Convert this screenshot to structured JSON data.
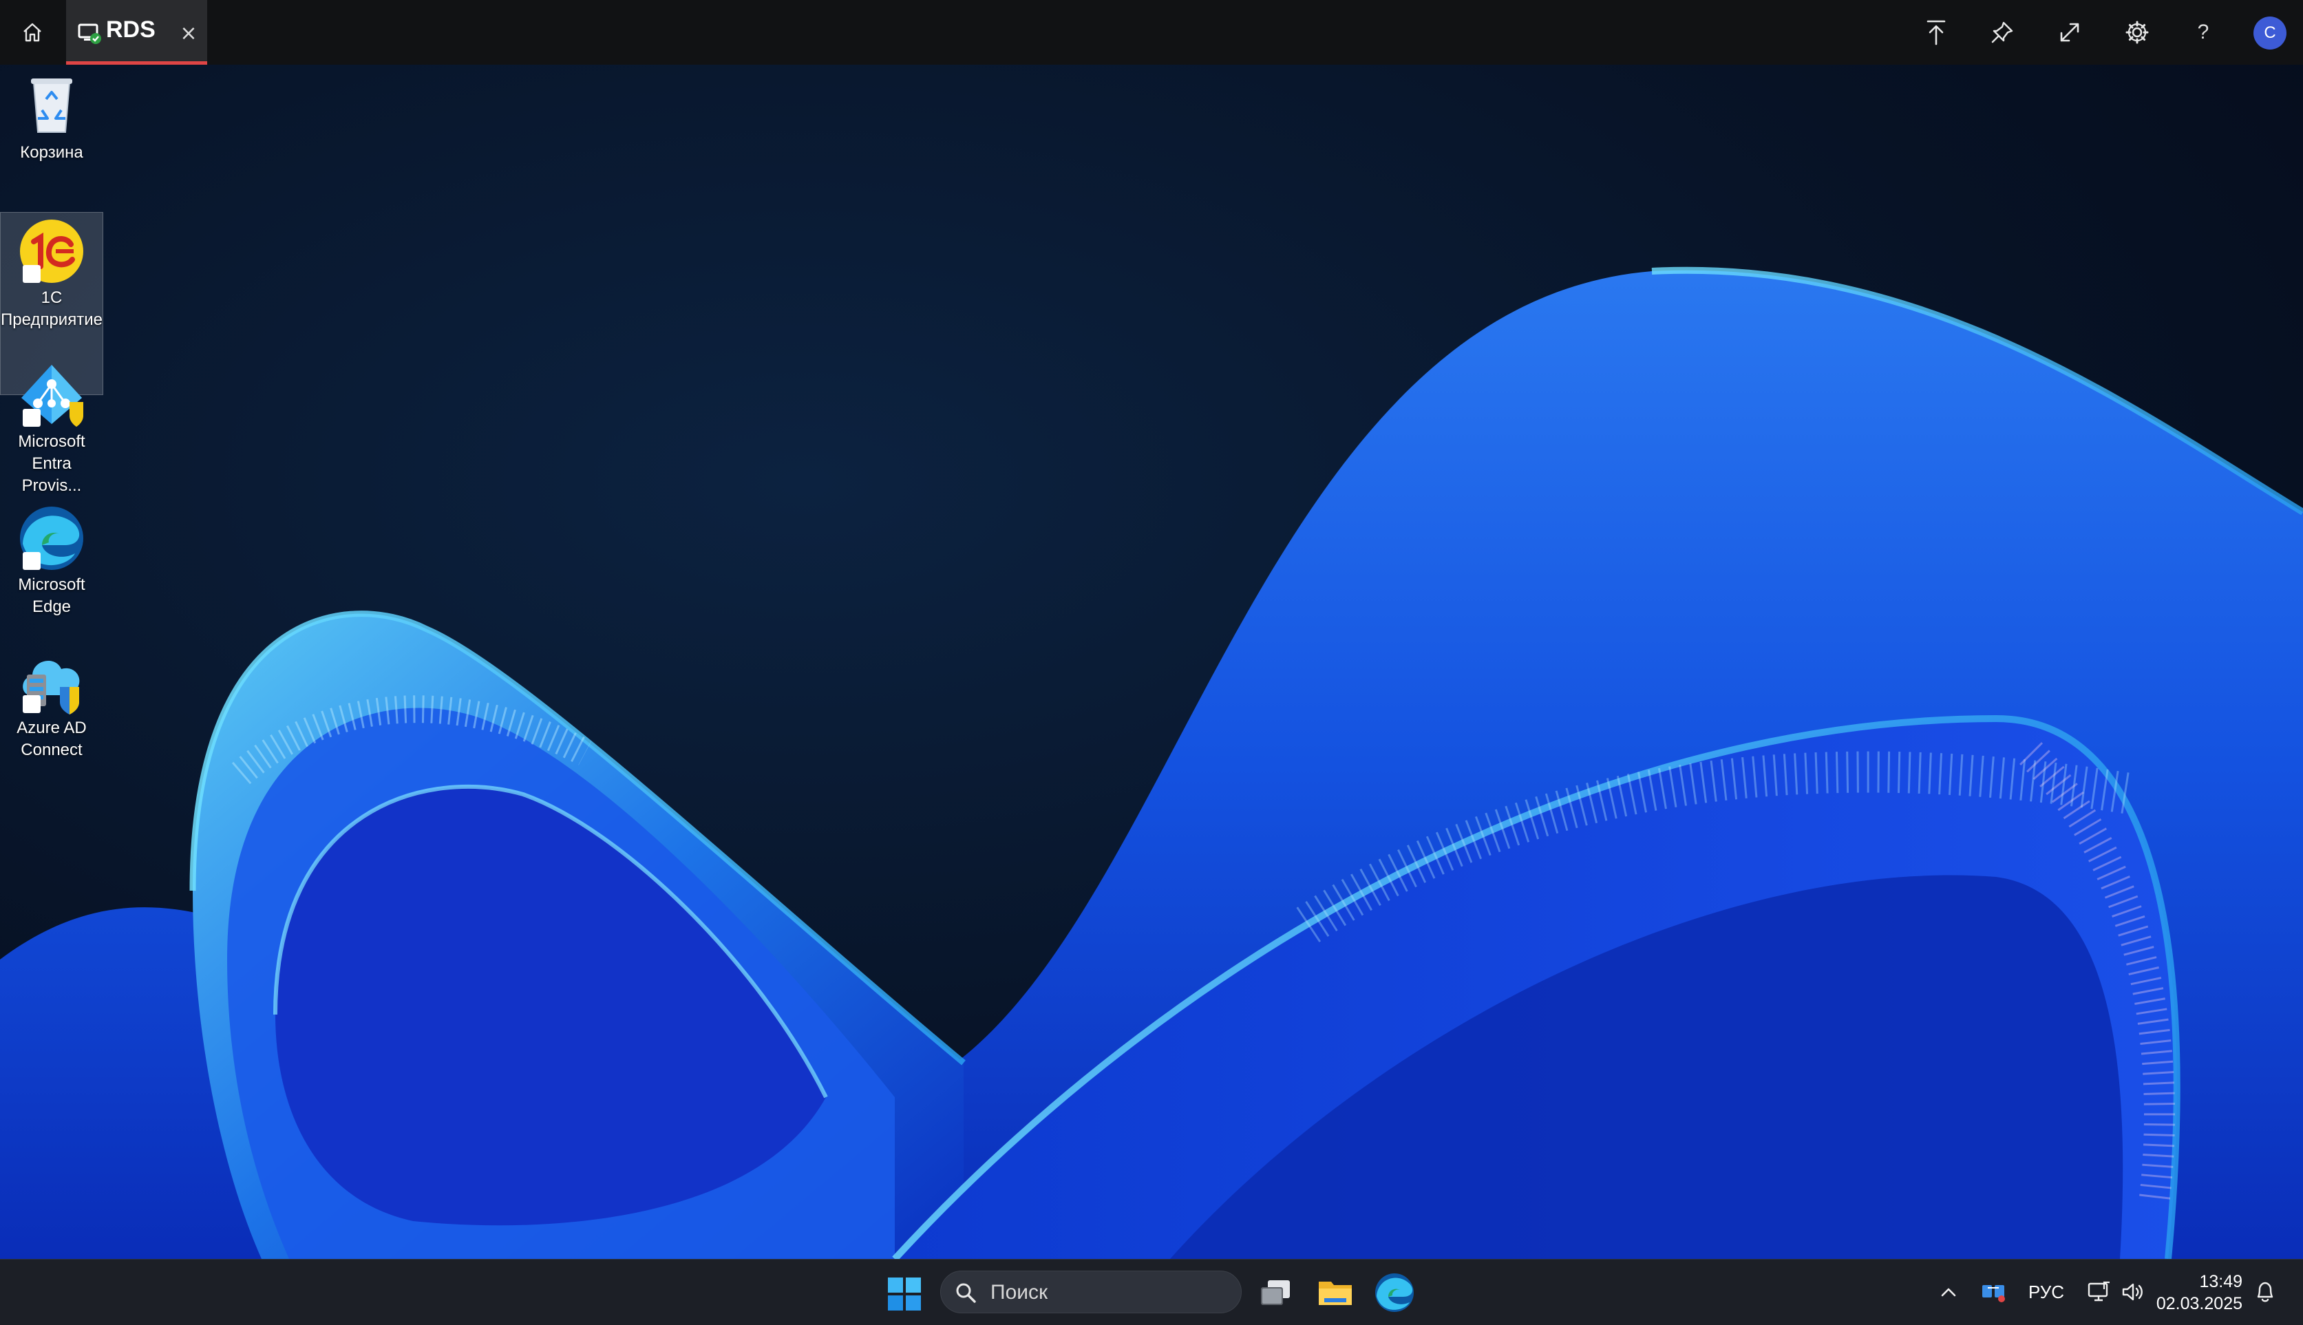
{
  "topbar": {
    "tab_label": "RDS",
    "close_glyph": "×",
    "help_glyph": "?",
    "avatar_initial": "C",
    "icons": [
      "home-icon",
      "remote-desktop-icon",
      "close-icon",
      "upload-icon",
      "pin-icon",
      "fullscreen-icon",
      "gear-icon",
      "help-icon"
    ],
    "accent_color": "#e04545"
  },
  "desktop": {
    "icons": [
      {
        "label": "Корзина",
        "icon": "recycle-bin-icon"
      },
      {
        "label": "1С\nПредприятие",
        "icon": "1c-enterprise-icon",
        "selected": true
      },
      {
        "label": "Microsoft\nEntra Provis...",
        "icon": "entra-provisioning-icon"
      },
      {
        "label": "Microsoft\nEdge",
        "icon": "edge-icon"
      },
      {
        "label": "Azure AD\nConnect",
        "icon": "azure-ad-connect-icon"
      }
    ]
  },
  "taskbar": {
    "search_placeholder": "Поиск",
    "apps": [
      "windows-start-icon",
      "task-view-icon",
      "file-explorer-icon",
      "edge-icon"
    ],
    "tray": {
      "language": "РУС",
      "icons": [
        "chevron-up-icon",
        "network-app-icon",
        "display-icon",
        "volume-icon",
        "bell-icon"
      ]
    },
    "time": "13:49",
    "date": "02.03.2025"
  }
}
